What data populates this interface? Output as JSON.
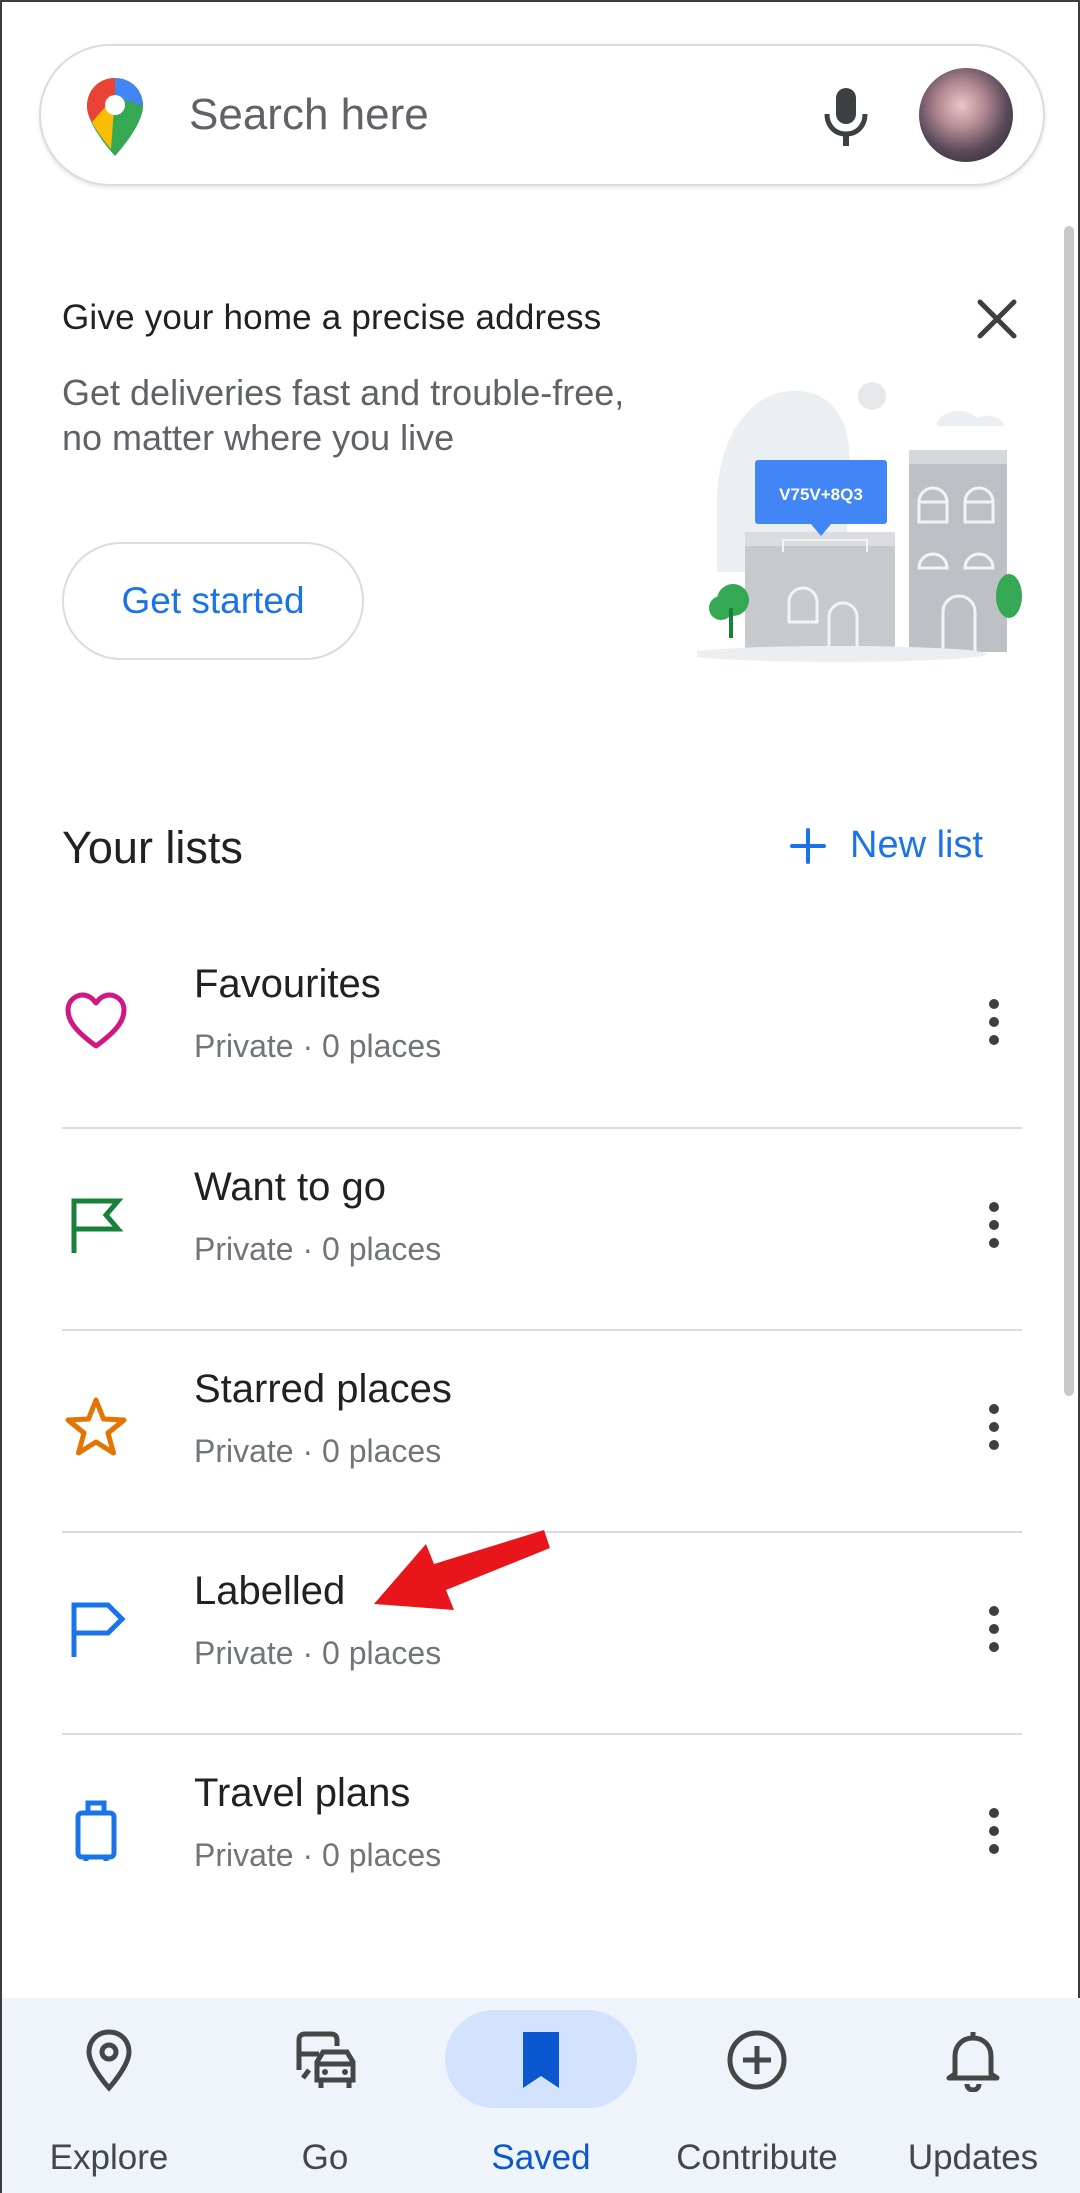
{
  "search": {
    "placeholder": "Search here"
  },
  "promo": {
    "title": "Give your home a precise address",
    "description": "Get deliveries fast and trouble-free, no matter where you live",
    "cta_label": "Get started",
    "plus_code": "V75V+8Q3"
  },
  "lists": {
    "heading": "Your lists",
    "new_list_label": "New list",
    "items": [
      {
        "title": "Favourites",
        "subtitle": "Private · 0 places",
        "icon": "heart-icon",
        "color": "#d01884"
      },
      {
        "title": "Want to go",
        "subtitle": "Private · 0 places",
        "icon": "flag-icon",
        "color": "#188038"
      },
      {
        "title": "Starred places",
        "subtitle": "Private · 0 places",
        "icon": "star-icon",
        "color": "#e37400"
      },
      {
        "title": "Labelled",
        "subtitle": "Private · 0 places",
        "icon": "label-flag-icon",
        "color": "#1a73e8"
      },
      {
        "title": "Travel plans",
        "subtitle": "Private · 0 places",
        "icon": "suitcase-icon",
        "color": "#1a73e8"
      }
    ]
  },
  "nav": {
    "items": [
      {
        "label": "Explore",
        "icon": "location-pin-icon"
      },
      {
        "label": "Go",
        "icon": "commute-icon"
      },
      {
        "label": "Saved",
        "icon": "bookmark-icon",
        "active": true
      },
      {
        "label": "Contribute",
        "icon": "add-circle-icon"
      },
      {
        "label": "Updates",
        "icon": "bell-icon"
      }
    ]
  },
  "colors": {
    "accent": "#1a73e8",
    "nav_active": "#0b57d0",
    "annotation": "#e8151b"
  }
}
